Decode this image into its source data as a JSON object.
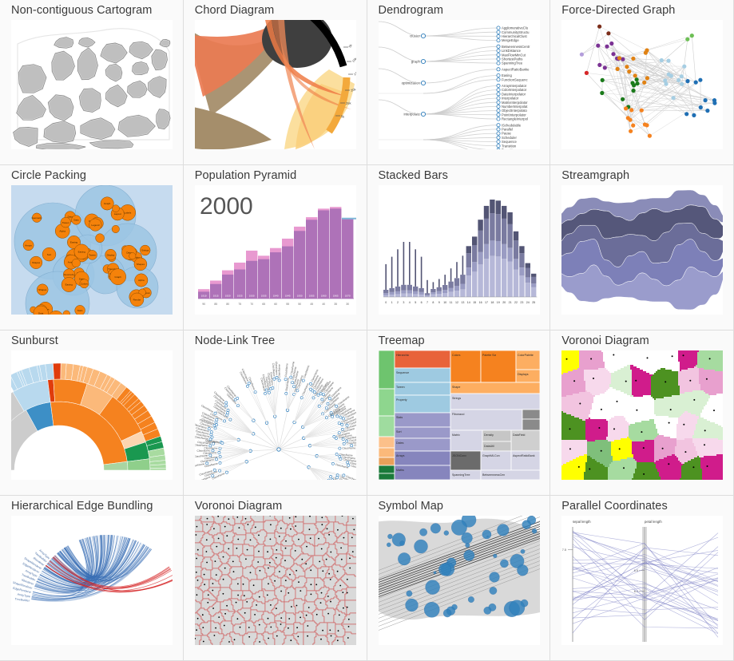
{
  "page": {
    "background": "#ffffff",
    "card_background": "#fafafa",
    "border_color": "#dddddd",
    "title_color": "#3a3a3a",
    "columns": 4
  },
  "cards": [
    {
      "id": "non-contiguous-cartogram",
      "title": "Non-contiguous Cartogram",
      "thumb": "cartogram"
    },
    {
      "id": "chord-diagram",
      "title": "Chord Diagram",
      "thumb": "chord"
    },
    {
      "id": "dendrogram",
      "title": "Dendrogram",
      "thumb": "dendrogram"
    },
    {
      "id": "force-directed-graph",
      "title": "Force-Directed Graph",
      "thumb": "force"
    },
    {
      "id": "circle-packing",
      "title": "Circle Packing",
      "thumb": "packing"
    },
    {
      "id": "population-pyramid",
      "title": "Population Pyramid",
      "thumb": "pyramid"
    },
    {
      "id": "stacked-bars",
      "title": "Stacked Bars",
      "thumb": "stacked"
    },
    {
      "id": "streamgraph",
      "title": "Streamgraph",
      "thumb": "stream"
    },
    {
      "id": "sunburst",
      "title": "Sunburst",
      "thumb": "sunburst"
    },
    {
      "id": "node-link-tree",
      "title": "Node-Link Tree",
      "thumb": "nodelink"
    },
    {
      "id": "treemap",
      "title": "Treemap",
      "thumb": "treemap"
    },
    {
      "id": "voronoi-diagram",
      "title": "Voronoi Diagram",
      "thumb": "voronoi"
    },
    {
      "id": "hierarchical-edge-bundling",
      "title": "Hierarchical Edge Bundling",
      "thumb": "bundling"
    },
    {
      "id": "voronoi-diagram-2",
      "title": "Voronoi Diagram",
      "thumb": "voronoi2"
    },
    {
      "id": "symbol-map",
      "title": "Symbol Map",
      "thumb": "symbolmap"
    },
    {
      "id": "parallel-coordinates",
      "title": "Parallel Coordinates",
      "thumb": "parallel"
    }
  ],
  "thumbnails": {
    "dendrogram": {
      "root_labels": [
        "cluster",
        "graph",
        "optimization",
        "interpolate"
      ],
      "leaf_labels": [
        "AgglomerativeClu",
        "CommunityStructu",
        "HierarchicalClust",
        "MergeEdge",
        "BetweennessCentr",
        "LinkDistance",
        "MaxFlowMinCut",
        "ShortestPaths",
        "SpanningTree",
        "AspectRatioBanke",
        "Easing",
        "FunctionSequenc",
        "ArrayInterpolator",
        "ColorInterpolator",
        "DateInterpolator",
        "Interpolator",
        "MatrixInterpolator",
        "NumberInterpolat",
        "ObjectInterpolato",
        "PointInterpolator",
        "RectangleInterpol",
        "ISchedulable",
        "Parallel",
        "Pause",
        "Scheduler",
        "Sequence",
        "Transition",
        "Transitioner",
        "TransitionEvent"
      ],
      "node_stroke": "#2b7bba",
      "link_color": "#cccccc"
    },
    "chord": {
      "colors": [
        "#000000",
        "#3f3f3f",
        "#a08c6a",
        "#e8633a",
        "#f4a582",
        "#fddb93",
        "#f7e0a0"
      ],
      "tick_labels": [
        "5k",
        "10k",
        "15k",
        "20k",
        "25k",
        "5k",
        "10k"
      ]
    },
    "force": {
      "node_colors": [
        "#7b3294",
        "#9970ab",
        "#e08214",
        "#fdb863",
        "#1a9641",
        "#4dac26",
        "#2c7bb6",
        "#92c5de",
        "#d7191c",
        "#7b3014"
      ],
      "link_color": "#cccccc"
    },
    "packing": {
      "outer_fill": "#c6dbef",
      "group_fill": "#9ecae1",
      "leaf_fill": "#f5820a",
      "leaf_stroke": "#8a4a00",
      "labels": [
        "Alpha",
        "Shapes",
        "Strings",
        "Display",
        "Data",
        "Sort",
        "Stats",
        "Geometry",
        "Arrays",
        "Colors",
        "Easing",
        "Tween",
        "Transition",
        "Query",
        "Graph",
        "Links",
        "Labels",
        "Layout",
        "Legend",
        "Render"
      ]
    },
    "pyramid": {
      "year_label": "2000",
      "bar_back_color": "#e899d0",
      "bar_front_color": "#a56cb4",
      "axis_labels": [
        "90",
        "85",
        "80",
        "75",
        "70",
        "65",
        "60",
        "55",
        "50",
        "45",
        "40",
        "35",
        "30"
      ],
      "cohort_labels": [
        "1910",
        "1915",
        "1920",
        "1925",
        "1930",
        "1935",
        "1940",
        "1945",
        "1950",
        "1955",
        "1960",
        "1965",
        "1970"
      ],
      "back_values": [
        11,
        21,
        33,
        42,
        56,
        50,
        59,
        70,
        84,
        95,
        105,
        107,
        94
      ],
      "front_values": [
        8,
        17,
        28,
        34,
        44,
        46,
        54,
        61,
        79,
        92,
        103,
        105,
        93
      ]
    },
    "stacked": {
      "x_labels": [
        "0",
        "1",
        "2",
        "3",
        "4",
        "5",
        "6",
        "7",
        "8",
        "9",
        "10",
        "11",
        "12",
        "13",
        "14",
        "15",
        "16",
        "17",
        "18",
        "19",
        "20",
        "21",
        "22",
        "23",
        "24",
        "25"
      ],
      "colors": [
        "#aeb0d4",
        "#8f91bd",
        "#6b6d96",
        "#4a4c6d"
      ],
      "totals": [
        31,
        38,
        45,
        52,
        52,
        45,
        38,
        16,
        14,
        17,
        21,
        27,
        33,
        39,
        48,
        57,
        73,
        86,
        92,
        91,
        86,
        80,
        62,
        48,
        32,
        22
      ]
    },
    "stream": {
      "colors": [
        "#9a9ccc",
        "#7d80b8",
        "#6b6d99",
        "#55577a",
        "#8a8cb8"
      ]
    },
    "sunburst": {
      "colors": [
        "#cccccc",
        "#f5821f",
        "#3d8fc6",
        "#a8d5a2",
        "#fbb97a",
        "#e03c0c",
        "#1a9850",
        "#a6dba0",
        "#b8d9ee",
        "#fcd5b0"
      ]
    },
    "nodelink": {
      "node_stroke": "#2b7bba",
      "link_color": "#dddddd",
      "label_color": "#555555"
    },
    "treemap": {
      "colors": [
        "#5eb85e",
        "#9ecae1",
        "#9a99c9",
        "#f5821f",
        "#fdae61",
        "#c9c9dd",
        "#bdbdbd",
        "#6b6b6b",
        "#1a7a3a"
      ],
      "labels": [
        "AspectRatioBank",
        "SpanningTree",
        "BetweennessCen",
        "LinkDistance",
        "ShortestPaths",
        "MaxFlowMinCut",
        "CommunitySt",
        "AggIo",
        "Hierarchic",
        "Sequence",
        "Tween",
        "Property",
        "Stats",
        "Sort",
        "Dates",
        "Arrays",
        "Maths",
        "Colors",
        "Palette Siz",
        "ColorPalette",
        "Displays",
        "Shape",
        "Strings",
        "Fibonacci",
        "Geometry",
        "Shapes",
        "Matrix",
        "Density",
        "DataField",
        "DataUtil",
        "JSONConv",
        "GraphMLCon"
      ]
    },
    "voronoi": {
      "colors": [
        "#d01c8b",
        "#e8a0ce",
        "#f2c4e0",
        "#f7d9ec",
        "#ffffff",
        "#d9f0d3",
        "#a6dba0",
        "#7fbf7b",
        "#4d9221",
        "#ffff00"
      ],
      "stroke": "#777777",
      "site_color": "#000000"
    },
    "bundling": {
      "link_color": "#3a6fb5",
      "highlight_color": "#d62728",
      "labels": [
        "TreeBuilder",
        "ArrayType",
        "EdgeRenderer",
        "ShapeRenderer",
        "IRenderer"
      ]
    },
    "voronoi2": {
      "cell_fill": "#d9d9d9",
      "stroke": "#d06060",
      "site_color": "#000000"
    },
    "symbolmap": {
      "land_fill": "#d9d9d9",
      "symbol_fill": "#3182bd",
      "border_color": "#ffffff"
    },
    "parallel": {
      "axis_labels": [
        "sepal length",
        "petal length"
      ],
      "tick_values": [
        "7.5",
        "6.5",
        "6.0"
      ],
      "line_color": "#7b7fc4",
      "axis_color": "#888888"
    }
  }
}
